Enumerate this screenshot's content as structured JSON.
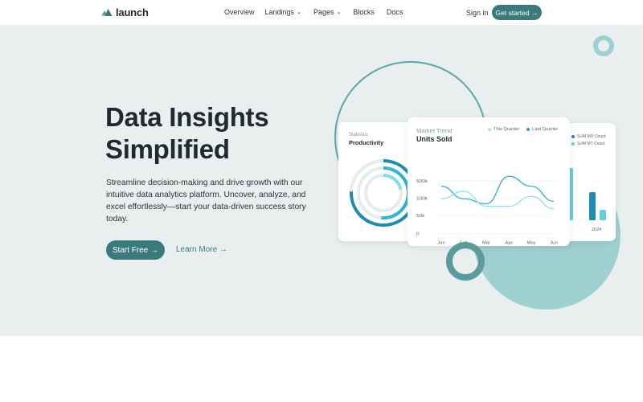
{
  "brand": {
    "name": "launch"
  },
  "nav": {
    "items": [
      {
        "label": "Overview",
        "has_dropdown": false
      },
      {
        "label": "Landings",
        "has_dropdown": true
      },
      {
        "label": "Pages",
        "has_dropdown": true
      },
      {
        "label": "Blocks",
        "has_dropdown": false
      },
      {
        "label": "Docs",
        "has_dropdown": false
      }
    ],
    "signin": "Sign in",
    "cta": "Get started →"
  },
  "hero": {
    "title_line1": "Data Insights",
    "title_line2": "Simplified",
    "description": "Streamline decision-making and drive growth with our intuitive data analytics platform. Uncover, analyze, and excel effortlessly—start your data-driven success story today.",
    "primary_button": "Start Free →",
    "secondary_button": "Learn More →"
  },
  "cards": {
    "productivity": {
      "label": "Statistics",
      "title": "Productivity"
    },
    "market": {
      "label": "Market Trend",
      "title": "Units Sold",
      "legend": [
        "This Quarter",
        "Last Quarter"
      ]
    },
    "counts": {
      "legend": [
        "SUM MO Count",
        "SUM MT Count"
      ],
      "year": "2024"
    }
  },
  "colors": {
    "brand": "#3b7a7c",
    "hero_bg": "#e9eeee",
    "accent_light": "#9fd0d1",
    "series_this": "#6fd2e6",
    "series_last": "#23a3c7",
    "bar_dark": "#1d8cb5",
    "bar_light": "#5fd0e3"
  },
  "chart_data": {
    "type": "line",
    "title": "Units Sold",
    "categories": [
      "Jan",
      "Feb",
      "Mar",
      "Apr",
      "May",
      "Jun"
    ],
    "yticks": [
      "500k",
      "100k",
      "50k",
      "0"
    ],
    "series": [
      {
        "name": "This Quarter",
        "values": [
          95,
          70,
          60,
          115,
          95,
          65
        ]
      },
      {
        "name": "Last Quarter",
        "values": [
          70,
          85,
          55,
          55,
          75,
          50
        ]
      }
    ]
  }
}
